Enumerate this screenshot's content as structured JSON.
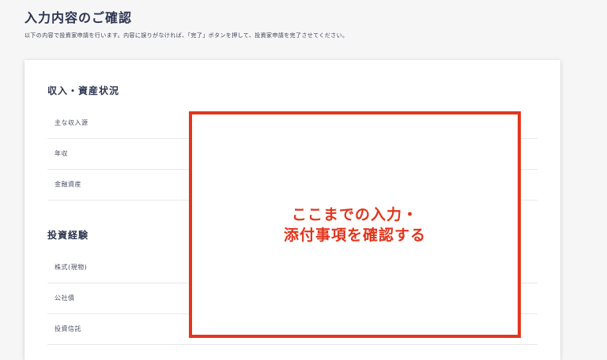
{
  "page": {
    "title": "入力内容のご確認",
    "description": "以下の内容で投資家申請を行います。内容に誤りがなければ、「完了」ボタンを押して、投資家申請を完了させてください。"
  },
  "sections": [
    {
      "heading": "収入・資産状況",
      "fields": [
        {
          "label": "主な収入源"
        },
        {
          "label": "年収"
        },
        {
          "label": "金融資産"
        }
      ]
    },
    {
      "heading": "投資経験",
      "fields": [
        {
          "label": "株式(現物)"
        },
        {
          "label": "公社債"
        },
        {
          "label": "投資信託"
        }
      ]
    }
  ],
  "annotation": {
    "line1": "ここまでの入力・",
    "line2": "添付事項を確認する",
    "color": "#e2351c"
  }
}
